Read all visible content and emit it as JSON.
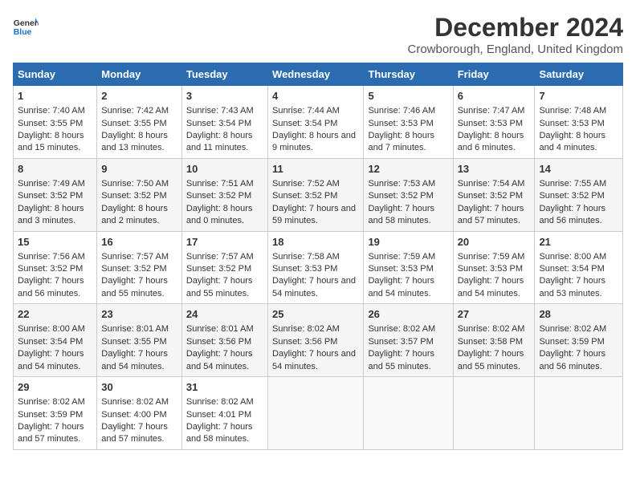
{
  "logo": {
    "text_general": "General",
    "text_blue": "Blue"
  },
  "title": "December 2024",
  "subtitle": "Crowborough, England, United Kingdom",
  "header_days": [
    "Sunday",
    "Monday",
    "Tuesday",
    "Wednesday",
    "Thursday",
    "Friday",
    "Saturday"
  ],
  "weeks": [
    [
      {
        "day": "1",
        "sunrise": "Sunrise: 7:40 AM",
        "sunset": "Sunset: 3:55 PM",
        "daylight": "Daylight: 8 hours and 15 minutes."
      },
      {
        "day": "2",
        "sunrise": "Sunrise: 7:42 AM",
        "sunset": "Sunset: 3:55 PM",
        "daylight": "Daylight: 8 hours and 13 minutes."
      },
      {
        "day": "3",
        "sunrise": "Sunrise: 7:43 AM",
        "sunset": "Sunset: 3:54 PM",
        "daylight": "Daylight: 8 hours and 11 minutes."
      },
      {
        "day": "4",
        "sunrise": "Sunrise: 7:44 AM",
        "sunset": "Sunset: 3:54 PM",
        "daylight": "Daylight: 8 hours and 9 minutes."
      },
      {
        "day": "5",
        "sunrise": "Sunrise: 7:46 AM",
        "sunset": "Sunset: 3:53 PM",
        "daylight": "Daylight: 8 hours and 7 minutes."
      },
      {
        "day": "6",
        "sunrise": "Sunrise: 7:47 AM",
        "sunset": "Sunset: 3:53 PM",
        "daylight": "Daylight: 8 hours and 6 minutes."
      },
      {
        "day": "7",
        "sunrise": "Sunrise: 7:48 AM",
        "sunset": "Sunset: 3:53 PM",
        "daylight": "Daylight: 8 hours and 4 minutes."
      }
    ],
    [
      {
        "day": "8",
        "sunrise": "Sunrise: 7:49 AM",
        "sunset": "Sunset: 3:52 PM",
        "daylight": "Daylight: 8 hours and 3 minutes."
      },
      {
        "day": "9",
        "sunrise": "Sunrise: 7:50 AM",
        "sunset": "Sunset: 3:52 PM",
        "daylight": "Daylight: 8 hours and 2 minutes."
      },
      {
        "day": "10",
        "sunrise": "Sunrise: 7:51 AM",
        "sunset": "Sunset: 3:52 PM",
        "daylight": "Daylight: 8 hours and 0 minutes."
      },
      {
        "day": "11",
        "sunrise": "Sunrise: 7:52 AM",
        "sunset": "Sunset: 3:52 PM",
        "daylight": "Daylight: 7 hours and 59 minutes."
      },
      {
        "day": "12",
        "sunrise": "Sunrise: 7:53 AM",
        "sunset": "Sunset: 3:52 PM",
        "daylight": "Daylight: 7 hours and 58 minutes."
      },
      {
        "day": "13",
        "sunrise": "Sunrise: 7:54 AM",
        "sunset": "Sunset: 3:52 PM",
        "daylight": "Daylight: 7 hours and 57 minutes."
      },
      {
        "day": "14",
        "sunrise": "Sunrise: 7:55 AM",
        "sunset": "Sunset: 3:52 PM",
        "daylight": "Daylight: 7 hours and 56 minutes."
      }
    ],
    [
      {
        "day": "15",
        "sunrise": "Sunrise: 7:56 AM",
        "sunset": "Sunset: 3:52 PM",
        "daylight": "Daylight: 7 hours and 56 minutes."
      },
      {
        "day": "16",
        "sunrise": "Sunrise: 7:57 AM",
        "sunset": "Sunset: 3:52 PM",
        "daylight": "Daylight: 7 hours and 55 minutes."
      },
      {
        "day": "17",
        "sunrise": "Sunrise: 7:57 AM",
        "sunset": "Sunset: 3:52 PM",
        "daylight": "Daylight: 7 hours and 55 minutes."
      },
      {
        "day": "18",
        "sunrise": "Sunrise: 7:58 AM",
        "sunset": "Sunset: 3:53 PM",
        "daylight": "Daylight: 7 hours and 54 minutes."
      },
      {
        "day": "19",
        "sunrise": "Sunrise: 7:59 AM",
        "sunset": "Sunset: 3:53 PM",
        "daylight": "Daylight: 7 hours and 54 minutes."
      },
      {
        "day": "20",
        "sunrise": "Sunrise: 7:59 AM",
        "sunset": "Sunset: 3:53 PM",
        "daylight": "Daylight: 7 hours and 54 minutes."
      },
      {
        "day": "21",
        "sunrise": "Sunrise: 8:00 AM",
        "sunset": "Sunset: 3:54 PM",
        "daylight": "Daylight: 7 hours and 53 minutes."
      }
    ],
    [
      {
        "day": "22",
        "sunrise": "Sunrise: 8:00 AM",
        "sunset": "Sunset: 3:54 PM",
        "daylight": "Daylight: 7 hours and 54 minutes."
      },
      {
        "day": "23",
        "sunrise": "Sunrise: 8:01 AM",
        "sunset": "Sunset: 3:55 PM",
        "daylight": "Daylight: 7 hours and 54 minutes."
      },
      {
        "day": "24",
        "sunrise": "Sunrise: 8:01 AM",
        "sunset": "Sunset: 3:56 PM",
        "daylight": "Daylight: 7 hours and 54 minutes."
      },
      {
        "day": "25",
        "sunrise": "Sunrise: 8:02 AM",
        "sunset": "Sunset: 3:56 PM",
        "daylight": "Daylight: 7 hours and 54 minutes."
      },
      {
        "day": "26",
        "sunrise": "Sunrise: 8:02 AM",
        "sunset": "Sunset: 3:57 PM",
        "daylight": "Daylight: 7 hours and 55 minutes."
      },
      {
        "day": "27",
        "sunrise": "Sunrise: 8:02 AM",
        "sunset": "Sunset: 3:58 PM",
        "daylight": "Daylight: 7 hours and 55 minutes."
      },
      {
        "day": "28",
        "sunrise": "Sunrise: 8:02 AM",
        "sunset": "Sunset: 3:59 PM",
        "daylight": "Daylight: 7 hours and 56 minutes."
      }
    ],
    [
      {
        "day": "29",
        "sunrise": "Sunrise: 8:02 AM",
        "sunset": "Sunset: 3:59 PM",
        "daylight": "Daylight: 7 hours and 57 minutes."
      },
      {
        "day": "30",
        "sunrise": "Sunrise: 8:02 AM",
        "sunset": "Sunset: 4:00 PM",
        "daylight": "Daylight: 7 hours and 57 minutes."
      },
      {
        "day": "31",
        "sunrise": "Sunrise: 8:02 AM",
        "sunset": "Sunset: 4:01 PM",
        "daylight": "Daylight: 7 hours and 58 minutes."
      },
      null,
      null,
      null,
      null
    ]
  ]
}
